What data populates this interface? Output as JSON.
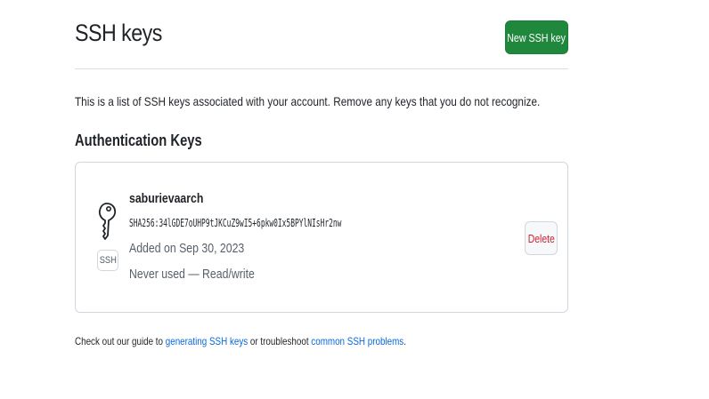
{
  "header": {
    "title": "SSH keys",
    "new_key_button": "New SSH key"
  },
  "description": "This is a list of SSH keys associated with your account. Remove any keys that you do not recognize.",
  "section": {
    "title": "Authentication Keys"
  },
  "key": {
    "icon": "key-icon",
    "badge": "SSH",
    "name": "saburievaarch",
    "fingerprint": "SHA256:34lGDE7oUHP9tJKCuZ9wI5+6pkw0Ix5BPYlNIsHr2nw",
    "added": "Added on Sep 30, 2023",
    "usage": "Never used — Read/write",
    "delete_button": "Delete"
  },
  "footer": {
    "prefix": "Check out our guide to ",
    "link1": "generating SSH keys",
    "middle": " or troubleshoot ",
    "link2": "common SSH problems",
    "suffix": "."
  },
  "colors": {
    "primary_button": "#1f883d",
    "danger": "#cf222e",
    "link": "#0969da",
    "muted": "#57606a",
    "border": "#d0d7de"
  }
}
